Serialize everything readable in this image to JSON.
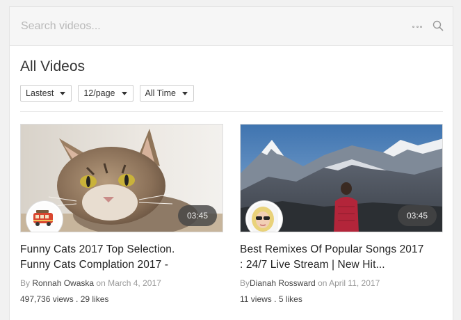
{
  "search": {
    "placeholder": "Search videos..."
  },
  "page": {
    "title": "All Videos"
  },
  "filters": [
    {
      "label": "Lastest"
    },
    {
      "label": "12/page"
    },
    {
      "label": "All Time"
    }
  ],
  "videos": [
    {
      "title_line1": "Funny Cats 2017 Top Selection.",
      "title_line2": "Funny Cats Complation 2017 -",
      "by_prefix": "By ",
      "author": "Ronnah Owaska",
      "on": " on ",
      "date": "March 4, 2017",
      "views": "497,736 views",
      "sep": " . ",
      "likes": "29 likes",
      "duration": "03:45",
      "thumbnail_icon": "cat-photo",
      "avatar_icon": "bus-avatar"
    },
    {
      "title_line1": "Best Remixes Of Popular Songs 2017",
      "title_line2": ": 24/7 Live Stream | New Hit...",
      "by_prefix": "By",
      "author": "Dianah Rossward",
      "on": " on ",
      "date": "April 11, 2017",
      "views": "11 views",
      "sep": " . ",
      "likes": "5 likes",
      "duration": "03:45",
      "thumbnail_icon": "mountain-photo",
      "avatar_icon": "woman-sunglasses-avatar"
    }
  ],
  "colors": {
    "panel": "#ffffff",
    "background": "#f1f1f1",
    "search_bar": "#f6f6f6",
    "duration_badge": "#464646"
  }
}
